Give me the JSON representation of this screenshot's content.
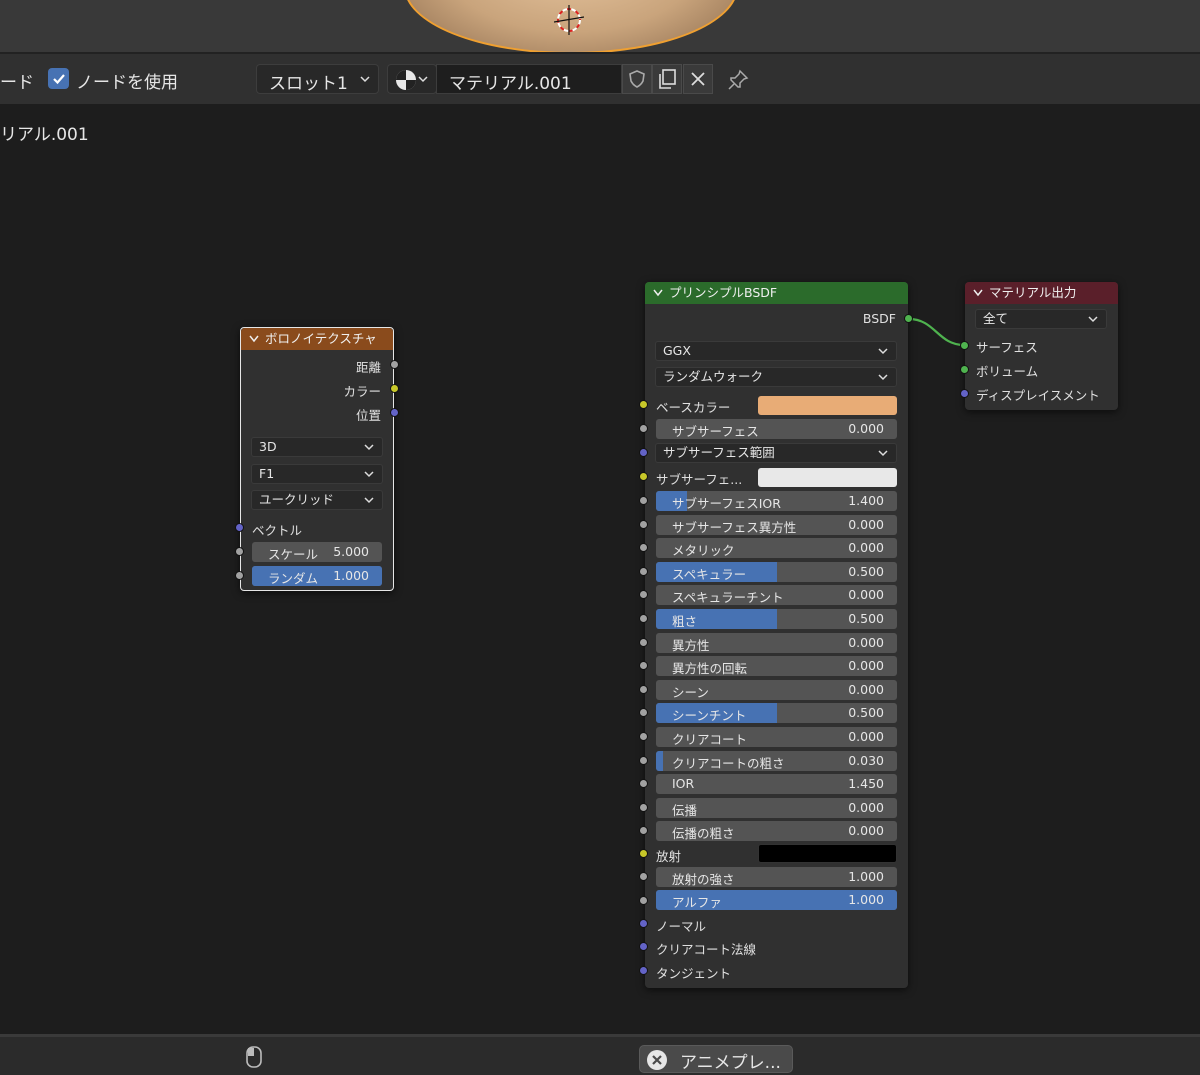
{
  "header": {
    "mode_partial": "ード",
    "use_nodes_label": "ノードを使用",
    "use_nodes_checked": true,
    "slot": "スロット1",
    "material_name": "マテリアル.001"
  },
  "editor": {
    "material_title_partial": "リアル.001"
  },
  "voronoi_node": {
    "title": "ボロノイテクスチャ",
    "header_color": "#8a4b1c",
    "outputs": [
      "距離",
      "カラー",
      "位置"
    ],
    "dimensions": "3D",
    "feature": "F1",
    "distance": "ユークリッド",
    "vector_input": "ベクトル",
    "scale_label": "スケール",
    "scale_value": "5.000",
    "randomness_label": "ランダム",
    "randomness_value": "1.000"
  },
  "bsdf_node": {
    "title": "プリンシプルBSDF",
    "header_color": "#2b6b2b",
    "output": "BSDF",
    "distribution": "GGX",
    "subsurface_method": "ランダムウォーク",
    "base_color_label": "ベースカラー",
    "base_color": "#e8ac76",
    "subsurface_label": "サブサーフェス",
    "subsurface_value": "0.000",
    "subsurface_radius_label": "サブサーフェス範囲",
    "subsurface_color_label": "サブサーフェ...",
    "subsurface_color": "#e8e8e8",
    "rows": [
      {
        "label": "サブサーフェスIOR",
        "value": "1.400",
        "fill": 0.13
      },
      {
        "label": "サブサーフェス異方性",
        "value": "0.000",
        "fill": 0
      },
      {
        "label": "メタリック",
        "value": "0.000",
        "fill": 0
      },
      {
        "label": "スペキュラー",
        "value": "0.500",
        "fill": 0.5
      },
      {
        "label": "スペキュラーチント",
        "value": "0.000",
        "fill": 0
      },
      {
        "label": "粗さ",
        "value": "0.500",
        "fill": 0.5
      },
      {
        "label": "異方性",
        "value": "0.000",
        "fill": 0
      },
      {
        "label": "異方性の回転",
        "value": "0.000",
        "fill": 0
      },
      {
        "label": "シーン",
        "value": "0.000",
        "fill": 0
      },
      {
        "label": "シーンチント",
        "value": "0.500",
        "fill": 0.5
      },
      {
        "label": "クリアコート",
        "value": "0.000",
        "fill": 0
      },
      {
        "label": "クリアコートの粗さ",
        "value": "0.030",
        "fill": 0.03
      },
      {
        "label": "IOR",
        "value": "1.450",
        "fill": 0
      },
      {
        "label": "伝播",
        "value": "0.000",
        "fill": 0
      },
      {
        "label": "伝播の粗さ",
        "value": "0.000",
        "fill": 0
      }
    ],
    "emission_label": "放射",
    "emission_color": "#000000",
    "emission_strength_label": "放射の強さ",
    "emission_strength_value": "1.000",
    "alpha_label": "アルファ",
    "alpha_value": "1.000",
    "alpha_fill": 1.0,
    "vector_inputs": [
      "ノーマル",
      "クリアコート法線",
      "タンジェント"
    ]
  },
  "output_node": {
    "title": "マテリアル出力",
    "header_color": "#5a1f2a",
    "target": "全て",
    "inputs": [
      "サーフェス",
      "ボリューム",
      "ディスプレイスメント"
    ]
  },
  "status_bar": {
    "notification": "アニメプレ..."
  }
}
